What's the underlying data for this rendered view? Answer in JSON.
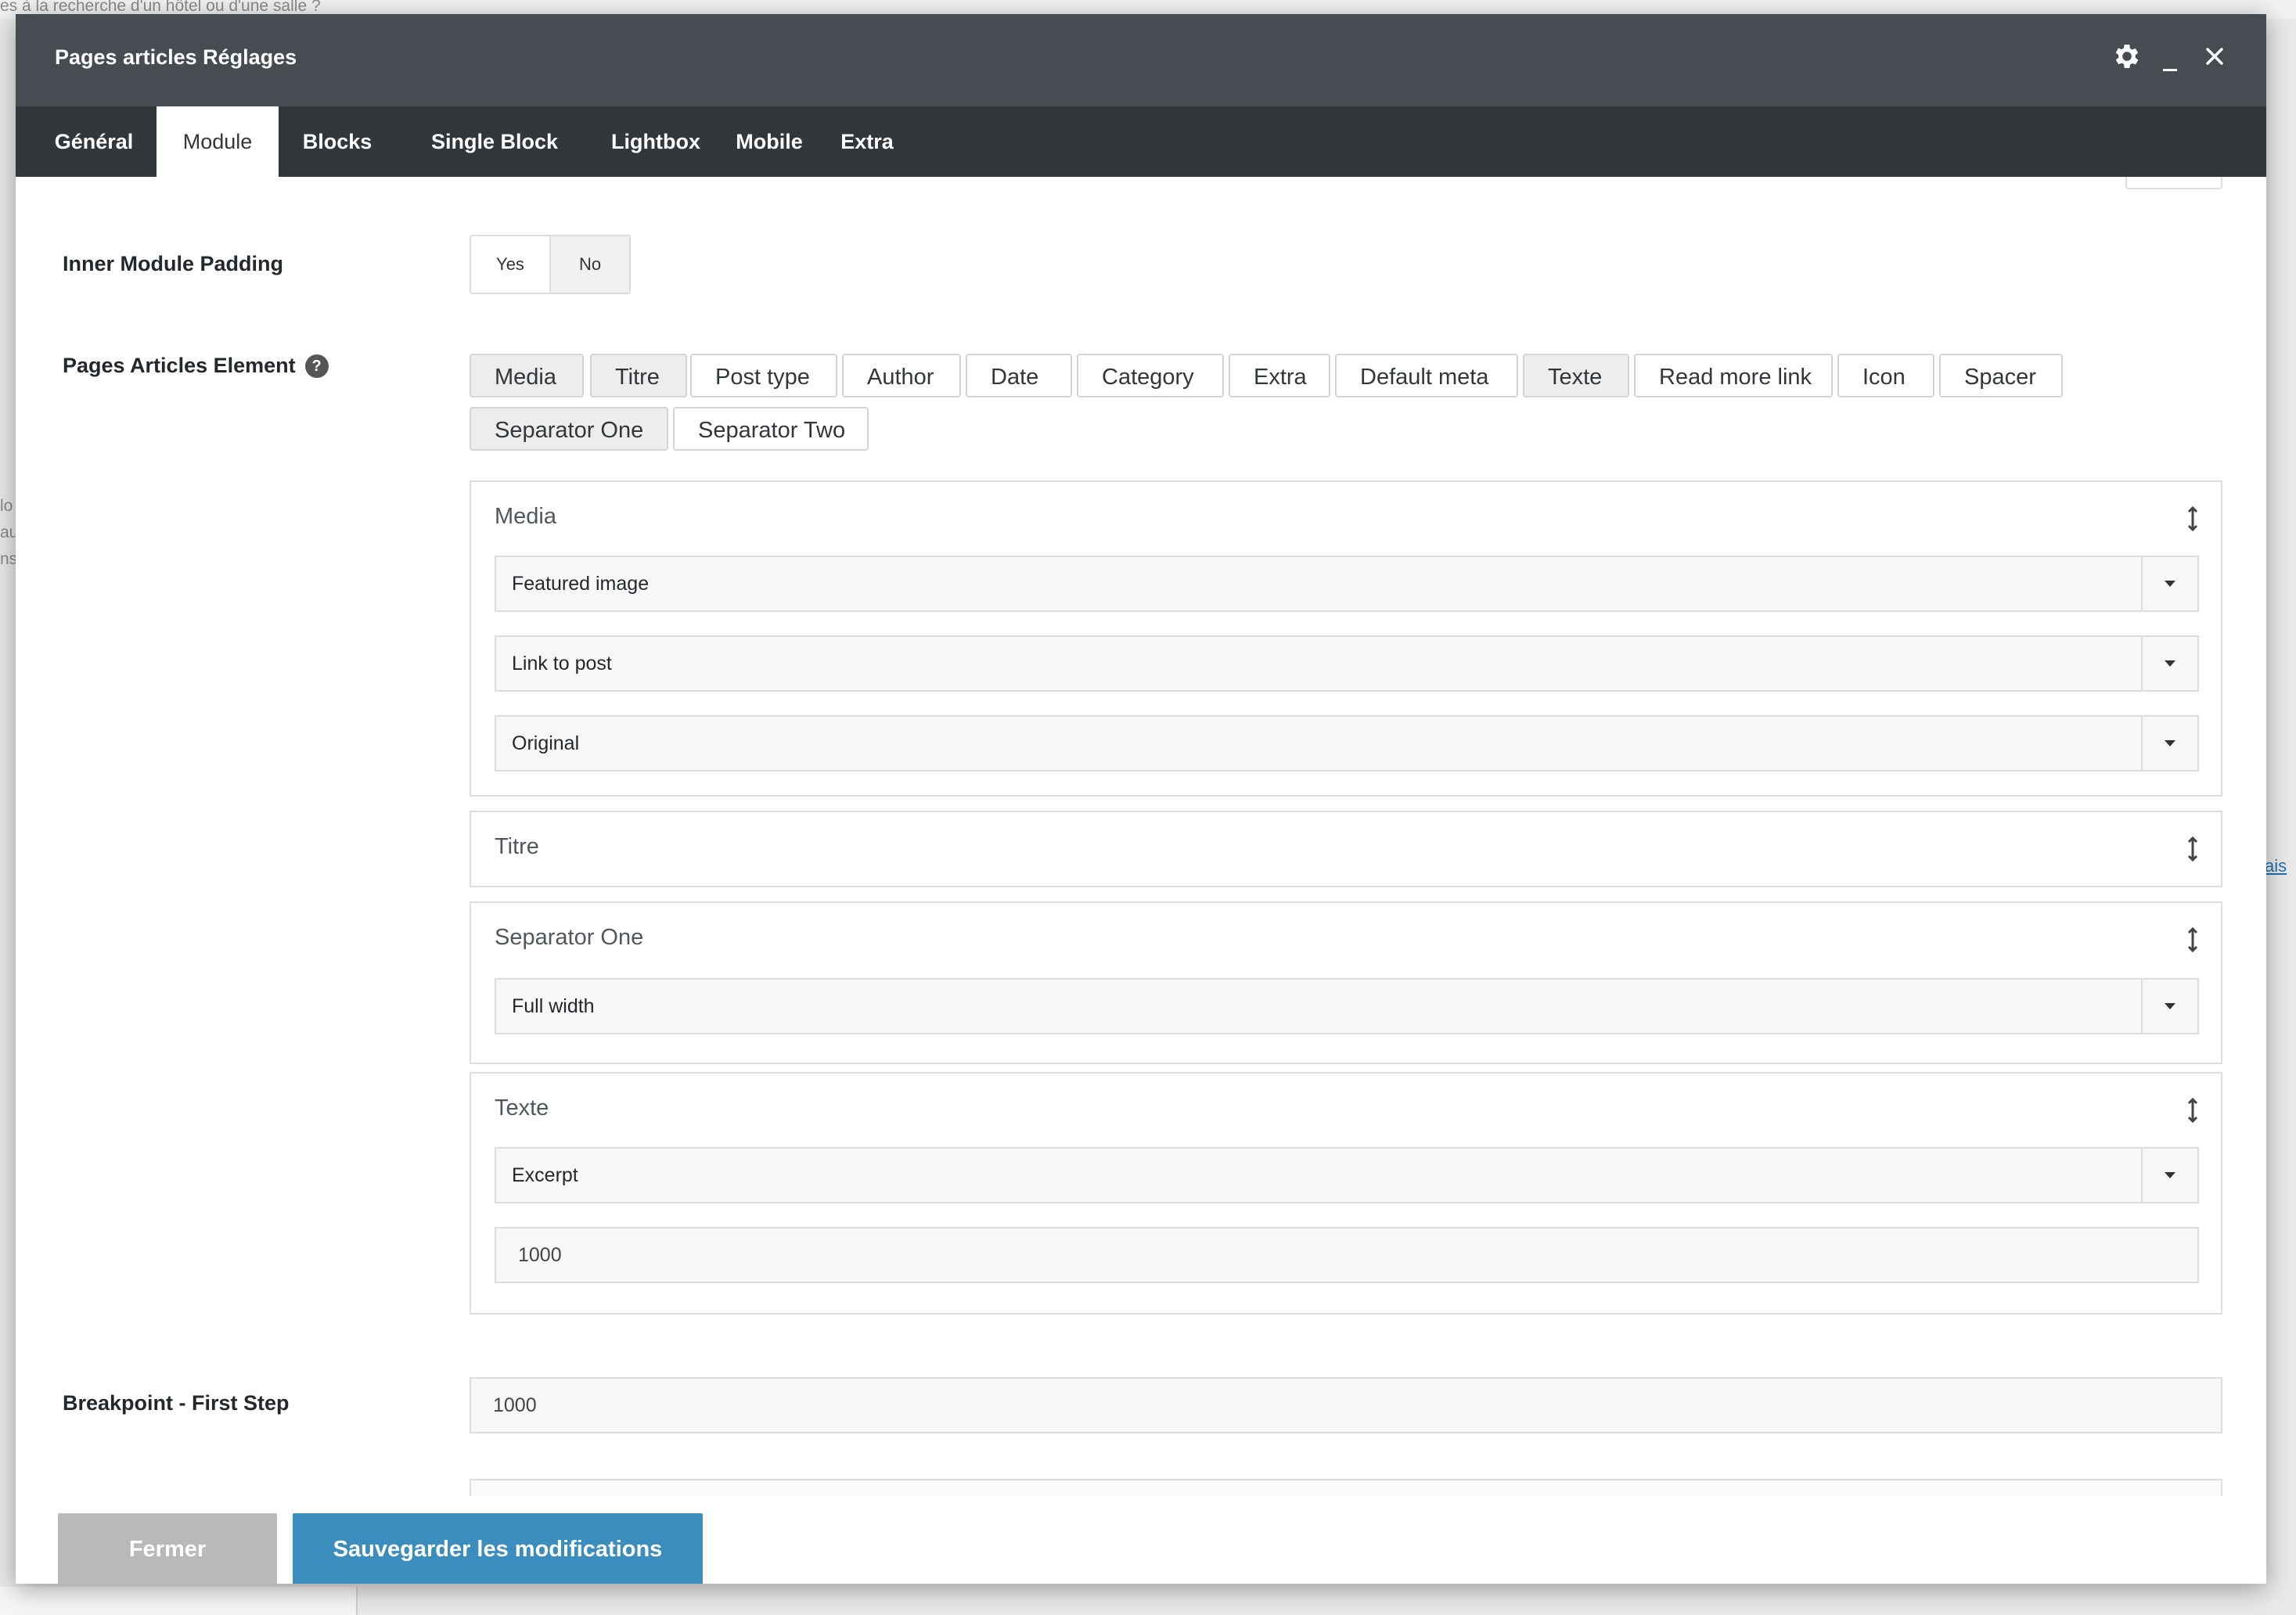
{
  "background": {
    "hint_text": "es à la recherche d'un hôtel ou d'une salle ?",
    "left_fragments": [
      "lo",
      "au",
      "ns"
    ],
    "right_link": "ais"
  },
  "modal": {
    "title": "Pages articles Réglages",
    "icons": [
      "gear-icon",
      "minimize-icon",
      "close-icon"
    ]
  },
  "tabs": [
    {
      "label": "Général",
      "active": false
    },
    {
      "label": "Module",
      "active": true
    },
    {
      "label": "Blocks",
      "active": false
    },
    {
      "label": "Single Block",
      "active": false
    },
    {
      "label": "Lightbox",
      "active": false
    },
    {
      "label": "Mobile",
      "active": false
    },
    {
      "label": "Extra",
      "active": false
    }
  ],
  "inner_padding": {
    "label": "Inner Module Padding",
    "yes": "Yes",
    "no": "No",
    "selected": "No"
  },
  "elements": {
    "label": "Pages Articles Element",
    "help": "?",
    "chips": [
      {
        "label": "Media",
        "selected": true
      },
      {
        "label": "Titre",
        "selected": true
      },
      {
        "label": "Post type",
        "selected": false
      },
      {
        "label": "Author",
        "selected": false
      },
      {
        "label": "Date",
        "selected": false
      },
      {
        "label": "Category",
        "selected": false
      },
      {
        "label": "Extra",
        "selected": false
      },
      {
        "label": "Default meta",
        "selected": false
      },
      {
        "label": "Texte",
        "selected": true
      },
      {
        "label": "Read more link",
        "selected": false
      },
      {
        "label": "Icon",
        "selected": false
      },
      {
        "label": "Spacer",
        "selected": false
      },
      {
        "label": "Separator One",
        "selected": true
      },
      {
        "label": "Separator Two",
        "selected": false
      }
    ]
  },
  "panels": {
    "media": {
      "title": "Media",
      "select1": "Featured image",
      "select2": "Link to post",
      "select3": "Original"
    },
    "titre": {
      "title": "Titre"
    },
    "separator": {
      "title": "Separator One",
      "select1": "Full width"
    },
    "texte": {
      "title": "Texte",
      "select1": "Excerpt",
      "input": "1000"
    }
  },
  "breakpoint": {
    "label": "Breakpoint - First Step",
    "value": "1000"
  },
  "footer": {
    "close_label": "Fermer",
    "save_label": "Sauvegarder les modifications"
  },
  "colors": {
    "header": "#474c53",
    "tabbar": "#32373c",
    "save_button": "#3b8dbd",
    "close_button": "#b9b9b9"
  }
}
